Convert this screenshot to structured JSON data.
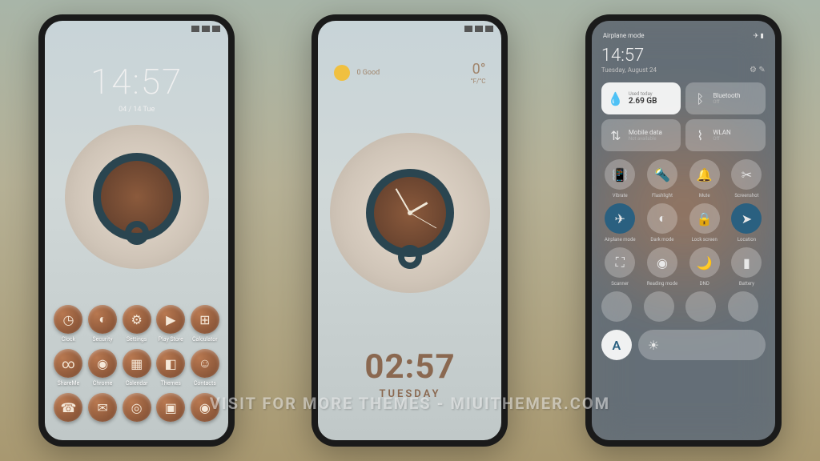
{
  "phone1": {
    "time": "14:57",
    "date": "04 / 14  Tue",
    "apps_row1": [
      {
        "label": "Clock",
        "glyph": "◷"
      },
      {
        "label": "Security",
        "glyph": "◐"
      },
      {
        "label": "Settings",
        "glyph": "⚙"
      },
      {
        "label": "Play Store",
        "glyph": "▶"
      },
      {
        "label": "Calculator",
        "glyph": "⊞"
      }
    ],
    "apps_row2": [
      {
        "label": "ShareMe",
        "glyph": "∞"
      },
      {
        "label": "Chrome",
        "glyph": "◉"
      },
      {
        "label": "Calendar",
        "glyph": "▦"
      },
      {
        "label": "Themes",
        "glyph": "◧"
      },
      {
        "label": "Contacts",
        "glyph": "☺"
      }
    ],
    "dock": [
      {
        "glyph": "☎"
      },
      {
        "glyph": "✉"
      },
      {
        "glyph": "◎"
      },
      {
        "glyph": "▣"
      },
      {
        "glyph": "◉"
      }
    ]
  },
  "phone2": {
    "weather_quality": "0  Good",
    "temp": "0°",
    "temp_unit": "°F/°C",
    "lock_time": "02:57",
    "lock_day": "TUESDAY"
  },
  "phone3": {
    "header_label": "Airplane mode",
    "time": "14:57",
    "date": "Tuesday, August 24",
    "tile_data_label": "Used today",
    "tile_data_value": "2.69 GB",
    "tile_bt": "Bluetooth",
    "tile_bt_sub": "Off",
    "tile_mobile": "Mobile data",
    "tile_mobile_sub": "Not available",
    "tile_wlan": "WLAN",
    "tile_wlan_sub": "Off",
    "toggles": [
      {
        "label": "Vibrate",
        "glyph": "📳",
        "active": false
      },
      {
        "label": "Flashlight",
        "glyph": "🔦",
        "active": false
      },
      {
        "label": "Mute",
        "glyph": "🔔",
        "active": false
      },
      {
        "label": "Screenshot",
        "glyph": "✂",
        "active": false
      },
      {
        "label": "Airplane mode",
        "glyph": "✈",
        "active": true
      },
      {
        "label": "Dark mode",
        "glyph": "◐",
        "active": false
      },
      {
        "label": "Lock screen",
        "glyph": "🔒",
        "active": false
      },
      {
        "label": "Location",
        "glyph": "➤",
        "active": true
      },
      {
        "label": "Scanner",
        "glyph": "⛶",
        "active": false
      },
      {
        "label": "Reading mode",
        "glyph": "◉",
        "active": false
      },
      {
        "label": "DND",
        "glyph": "🌙",
        "active": false
      },
      {
        "label": "Battery",
        "glyph": "▮",
        "active": false
      }
    ],
    "auto_label": "A"
  },
  "watermark": "VISIT FOR MORE THEMES - MIUITHEMER.COM"
}
